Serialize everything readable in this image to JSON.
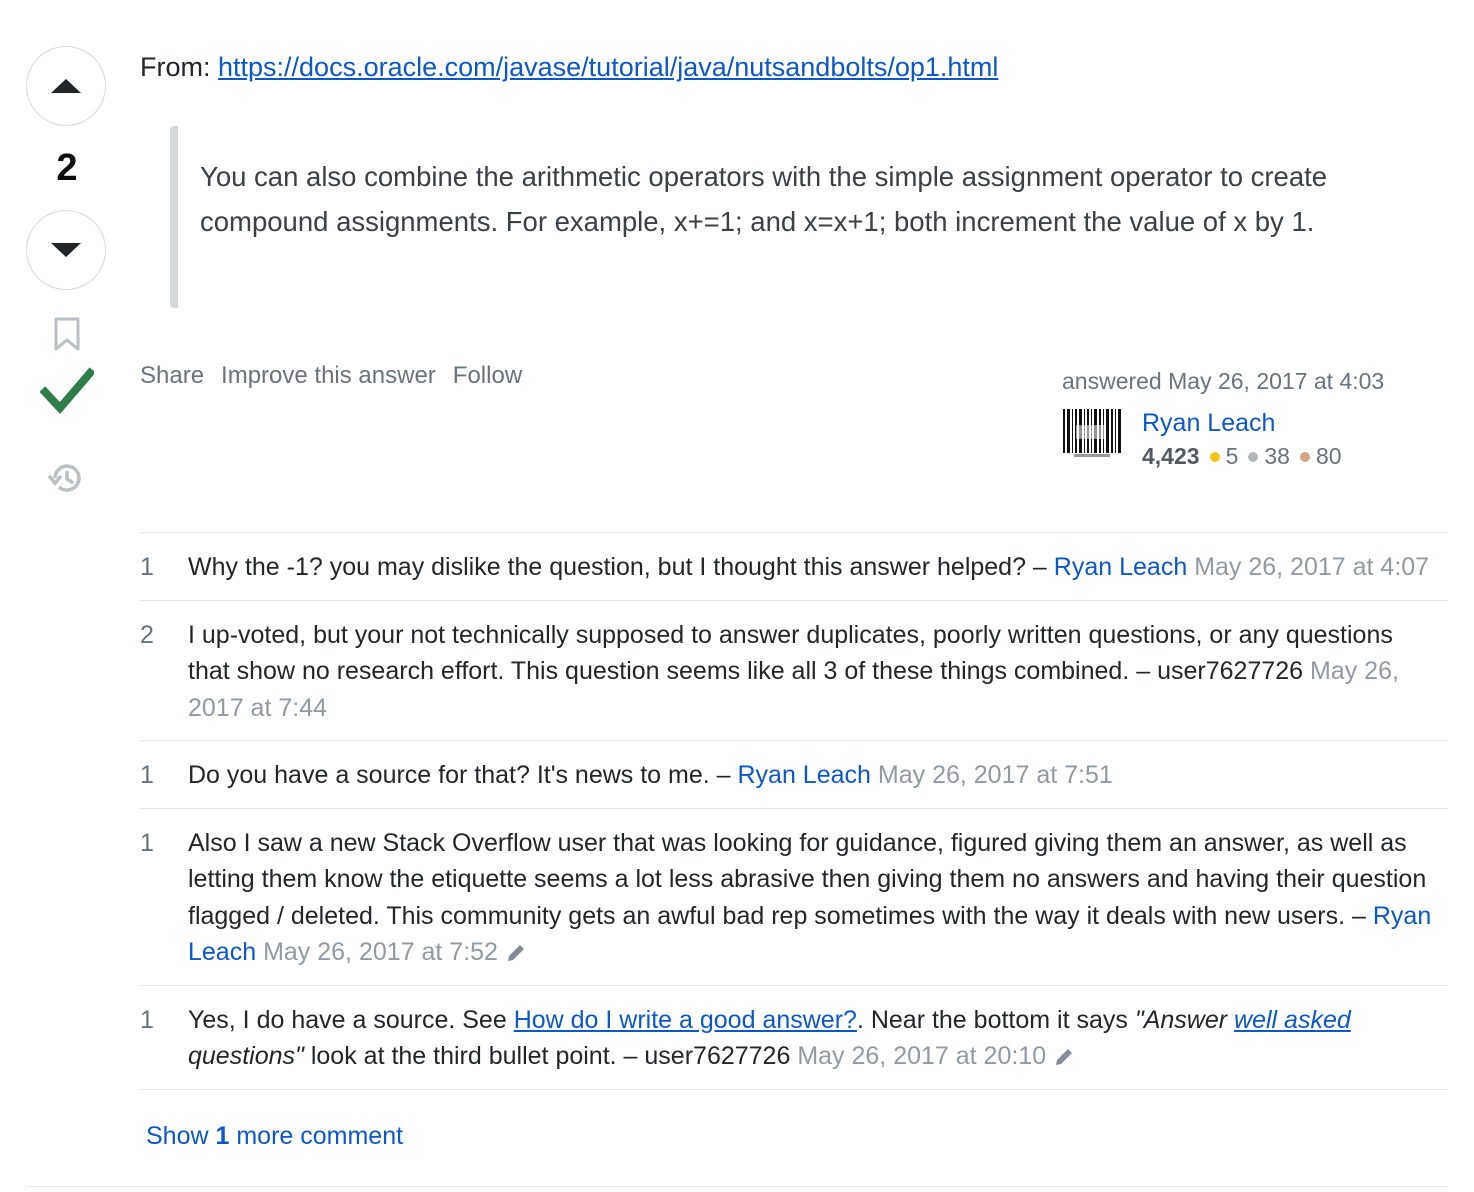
{
  "vote": {
    "score": "2"
  },
  "answer": {
    "from_label": "From: ",
    "from_url": "https://docs.oracle.com/javase/tutorial/java/nutsandbolts/op1.html",
    "quote": "You can also combine the arithmetic operators with the simple assignment operator to create compound assignments. For example, x+=1; and x=x+1; both increment the value of x by 1."
  },
  "post_menu": {
    "share": "Share",
    "improve": "Improve this answer",
    "follow": "Follow"
  },
  "signature": {
    "action": "answered May 26, 2017 at 4:03",
    "user": "Ryan Leach",
    "reputation": "4,423",
    "gold": "5",
    "silver": "38",
    "bronze": "80",
    "colors": {
      "gold": "#f5c518",
      "silver": "#b4b8bc",
      "bronze": "#d1a684"
    }
  },
  "comments": [
    {
      "score": "1",
      "text": "Why the -1? you may dislike the question, but I thought this answer helped? – ",
      "user": "Ryan Leach",
      "date": "May 26, 2017 at 4:07"
    },
    {
      "score": "2",
      "text": "I up-voted, but your not technically supposed to answer duplicates, poorly written questions, or any questions that show no research effort. This question seems like all 3 of these things combined. – ",
      "user": "user7627726",
      "date": "May 26, 2017 at 7:44"
    },
    {
      "score": "1",
      "text": "Do you have a source for that? It's news to me. – ",
      "user": "Ryan Leach",
      "date": "May 26, 2017 at 7:51"
    },
    {
      "score": "1",
      "text": "Also I saw a new Stack Overflow user that was looking for guidance, figured giving them an answer, as well as letting them know the etiquette seems a lot less abrasive then giving them no answers and having their question flagged / deleted. This community gets an awful bad rep sometimes with the way it deals with new users. – ",
      "user": "Ryan Leach",
      "date": "May 26, 2017 at 7:52"
    },
    {
      "score": "1",
      "text_a": "Yes, I do have a source. See ",
      "link": "How do I write a good answer?",
      "text_b": ". Near the bottom it says ",
      "quote_a": "\"Answer ",
      "quote_link": "well asked",
      "quote_b": " questions\"",
      "text_c": " look at the third bullet point. – ",
      "user": "user7627726",
      "date": "May 26, 2017 at 20:10"
    }
  ],
  "show_more": {
    "pre": "Show ",
    "count": "1",
    "post": " more comment"
  }
}
